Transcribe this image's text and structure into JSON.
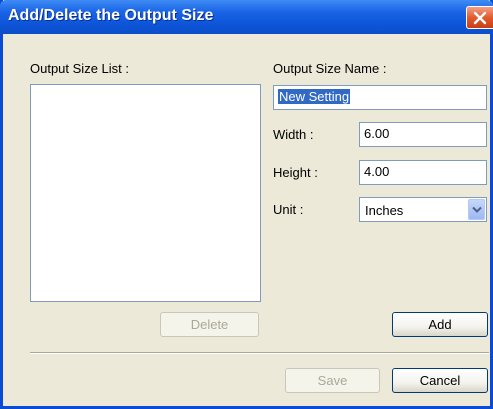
{
  "window": {
    "title": "Add/Delete the Output Size",
    "close_icon": "close-icon"
  },
  "output_size_list": {
    "label": "Output Size List :",
    "items": []
  },
  "form": {
    "name_label": "Output Size Name :",
    "name_value": "New Setting",
    "width_label": "Width :",
    "width_value": "6.00",
    "height_label": "Height :",
    "height_value": "4.00",
    "unit_label": "Unit :",
    "unit_value": "Inches"
  },
  "buttons": {
    "delete": "Delete",
    "add": "Add",
    "save": "Save",
    "cancel": "Cancel"
  },
  "colors": {
    "title_bar": "#0b4ec8",
    "dialog_bg": "#ece9d8",
    "selection": "#316ac5"
  }
}
